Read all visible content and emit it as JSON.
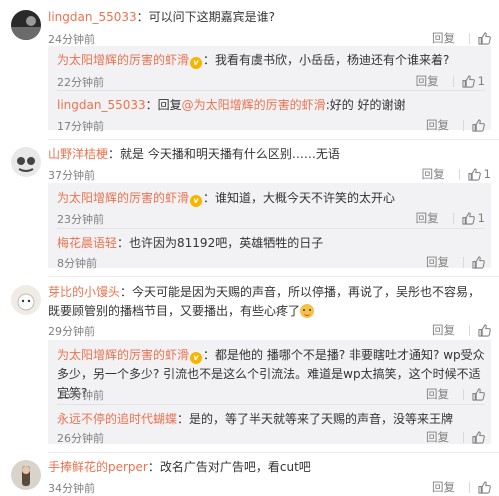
{
  "actions": {
    "reply": "回复",
    "like_icon": "thumbs-up-icon"
  },
  "colors": {
    "name": "#eb7350",
    "text": "#333333",
    "time": "#808080",
    "sub_bg": "#f2f2f5"
  },
  "comments": [
    {
      "name": "lingdan_55033",
      "sep": "：",
      "text": "可以问下这期嘉宾是谁?",
      "time": "24分钟前",
      "replies": [
        {
          "name": "为太阳增辉的厉害的虾滑",
          "sep": "：",
          "text": "我看有虞书欣，小岳岳，杨迪还有个谁来着?",
          "time": "22分钟前",
          "likes": "1"
        },
        {
          "name": "lingdan_55033",
          "sep": "：",
          "text_prefix": "回复",
          "mention": "@为太阳增辉的厉害的虾滑",
          "text": ":好的 好的谢谢",
          "time": "17分钟前"
        }
      ]
    },
    {
      "name": "山野洋桔梗",
      "sep": "：",
      "text": "就是 今天播和明天播有什么区别……无语",
      "time": "37分钟前",
      "likes": "1",
      "replies": [
        {
          "name": "为太阳增辉的厉害的虾滑",
          "sep": "：",
          "text": "谁知道，大概今天不许笑的太开心",
          "time": "23分钟前",
          "likes": "1"
        },
        {
          "name": "梅花晨语轻",
          "sep": "：",
          "text": "也许因为81192吧，英雄牺牲的日子",
          "time": "8分钟前"
        }
      ]
    },
    {
      "name": "芽比的小馒头",
      "sep": "：",
      "text": "今天可能是因为天赐的声音，所以停播，再说了，吴彤也不容易，既要顾管别的播档节目，又要播出，有些心疼了",
      "time": "29分钟前",
      "replies": [
        {
          "name": "为太阳增辉的厉害的虾滑",
          "sep": "：",
          "text": "都是他的 播哪个不是播? 非要瞎吐才通知? wp受众多少，另一个多少? 引流也不是这么个引流法。难道是wp太搞笑，这个时候不适宜笑?",
          "time": "25分钟前"
        },
        {
          "name": "永远不停的追时代蝴蝶",
          "sep": "：",
          "text": "是的，等了半天就等来了天赐的声音，没等来王牌",
          "time": "26分钟前"
        }
      ]
    },
    {
      "name": "手捧鲜花的perper",
      "sep": "：",
      "text": "改名广告对广告吧，看cut吧",
      "time": "34分钟前"
    }
  ]
}
